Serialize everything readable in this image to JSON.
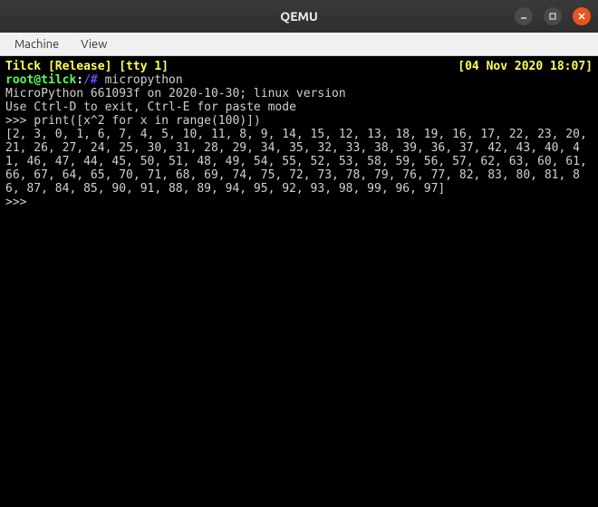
{
  "titlebar": {
    "title": "QEMU"
  },
  "menubar": {
    "machine": "Machine",
    "view": "View"
  },
  "terminal": {
    "status_left": "Tilck [Release] [tty 1]",
    "status_right": "[04 Nov 2020 18:07]",
    "prompt_user": "root@tilck",
    "prompt_sep": ":",
    "prompt_path": "/#",
    "command": " micropython",
    "mp_banner": "MicroPython 661093f on 2020-10-30; linux version",
    "mp_hint": "Use Ctrl-D to exit, Ctrl-E for paste mode",
    "repl_prompt1": ">>> ",
    "input1": "print([x^2 for x in range(100)])",
    "output": "[2, 3, 0, 1, 6, 7, 4, 5, 10, 11, 8, 9, 14, 15, 12, 13, 18, 19, 16, 17, 22, 23, 20, 21, 26, 27, 24, 25, 30, 31, 28, 29, 34, 35, 32, 33, 38, 39, 36, 37, 42, 43, 40, 41, 46, 47, 44, 45, 50, 51, 48, 49, 54, 55, 52, 53, 58, 59, 56, 57, 62, 63, 60, 61, 66, 67, 64, 65, 70, 71, 68, 69, 74, 75, 72, 73, 78, 79, 76, 77, 82, 83, 80, 81, 86, 87, 84, 85, 90, 91, 88, 89, 94, 95, 92, 93, 98, 99, 96, 97]",
    "repl_prompt2": ">>> "
  }
}
